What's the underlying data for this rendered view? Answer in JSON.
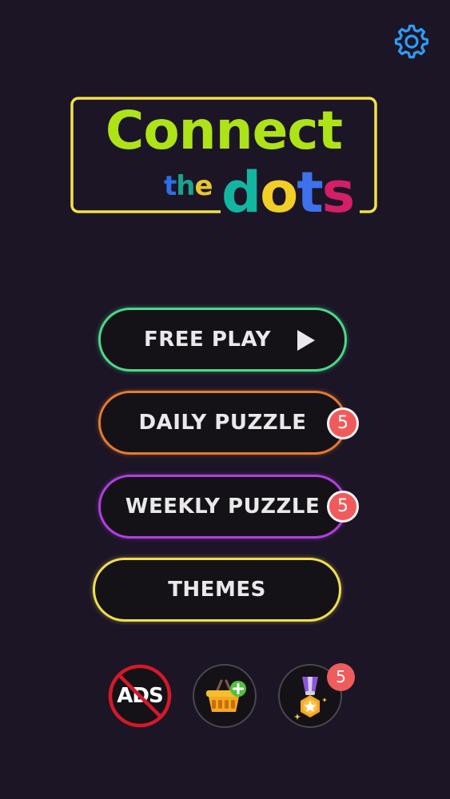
{
  "app": {
    "logo": {
      "word1": "Connect",
      "word2": "the",
      "word3": "dots",
      "word2_letters": [
        {
          "ch": "t",
          "color": "#2b6fe6"
        },
        {
          "ch": "h",
          "color": "#19a38a"
        },
        {
          "ch": "e",
          "color": "#e7c62e"
        }
      ],
      "word3_letters": [
        {
          "ch": "d",
          "color": "#12b6a0"
        },
        {
          "ch": "o",
          "color": "#f2ce26"
        },
        {
          "ch": "t",
          "color": "#3d72ec"
        },
        {
          "ch": "s",
          "color": "#d31f66"
        }
      ],
      "frame_color": "#f2e04a",
      "word1_color": "#aee317"
    }
  },
  "header": {
    "settings_icon": "gear-icon",
    "settings_color": "#2e9cf4"
  },
  "menu": {
    "free_play_label": "FREE PLAY",
    "free_play_icon": "play-icon",
    "daily_puzzle_label": "DAILY PUZZLE",
    "daily_puzzle_badge": "5",
    "weekly_puzzle_label": "WEEKLY PUZZLE",
    "weekly_puzzle_badge": "5",
    "themes_label": "THEMES",
    "colors": {
      "free_play": "#4bd88a",
      "daily_puzzle": "#e47b2d",
      "weekly_puzzle": "#b13fe0",
      "themes": "#f2de4c",
      "badge": "#f15a5a"
    }
  },
  "bottom_bar": {
    "no_ads_label": "ADS",
    "no_ads_icon": "no-ads-icon",
    "shop_icon": "shopping-basket-icon",
    "reward_icon": "medal-icon",
    "reward_badge": "5"
  }
}
